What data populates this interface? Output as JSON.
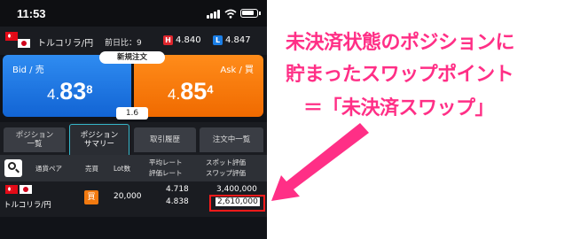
{
  "status_bar": {
    "time": "11:53"
  },
  "pair": {
    "name": "トルコリラ/円",
    "prev_day_label": "前日比：9",
    "high": {
      "badge": "H",
      "value": "4.840"
    },
    "low": {
      "badge": "L",
      "value": "4.847"
    }
  },
  "quote": {
    "bid": {
      "label": "Bid / 売",
      "small": "4.",
      "big": "83",
      "sup": "8"
    },
    "ask": {
      "label": "Ask / 買",
      "small": "4.",
      "big": "85",
      "sup": "4"
    },
    "new_order_label": "新規注文",
    "spread": "1.6"
  },
  "tabs": [
    {
      "label": "ポジション\n一覧"
    },
    {
      "label": "ポジション\nサマリー"
    },
    {
      "label": "取引履歴"
    },
    {
      "label": "注文中一覧"
    }
  ],
  "table": {
    "headers": {
      "pair": "通貨ペア",
      "side": "売買",
      "lot": "Lot数",
      "avg_rate": "平均レート",
      "eval_rate": "評価レート",
      "spot_eval": "スポット評価",
      "swap_eval": "スワップ評価"
    },
    "row": {
      "pair": "トルコリラ/円",
      "side": "買",
      "lot": "20,000",
      "avg_rate": "4.718",
      "eval_rate": "4.838",
      "spot_eval": "3,400,000",
      "swap_eval": "2,610,000"
    }
  },
  "annotation": {
    "line1": "未決済状態のポジションに",
    "line2": "貯まったスワップポイント",
    "line3": "＝「未決済スワップ」",
    "color": "#ff2f86"
  },
  "colors": {
    "bid": "#1e7be6",
    "ask": "#f57a0a",
    "active_tab": "#35b6c9",
    "highlight_box": "#ff1a1a"
  }
}
